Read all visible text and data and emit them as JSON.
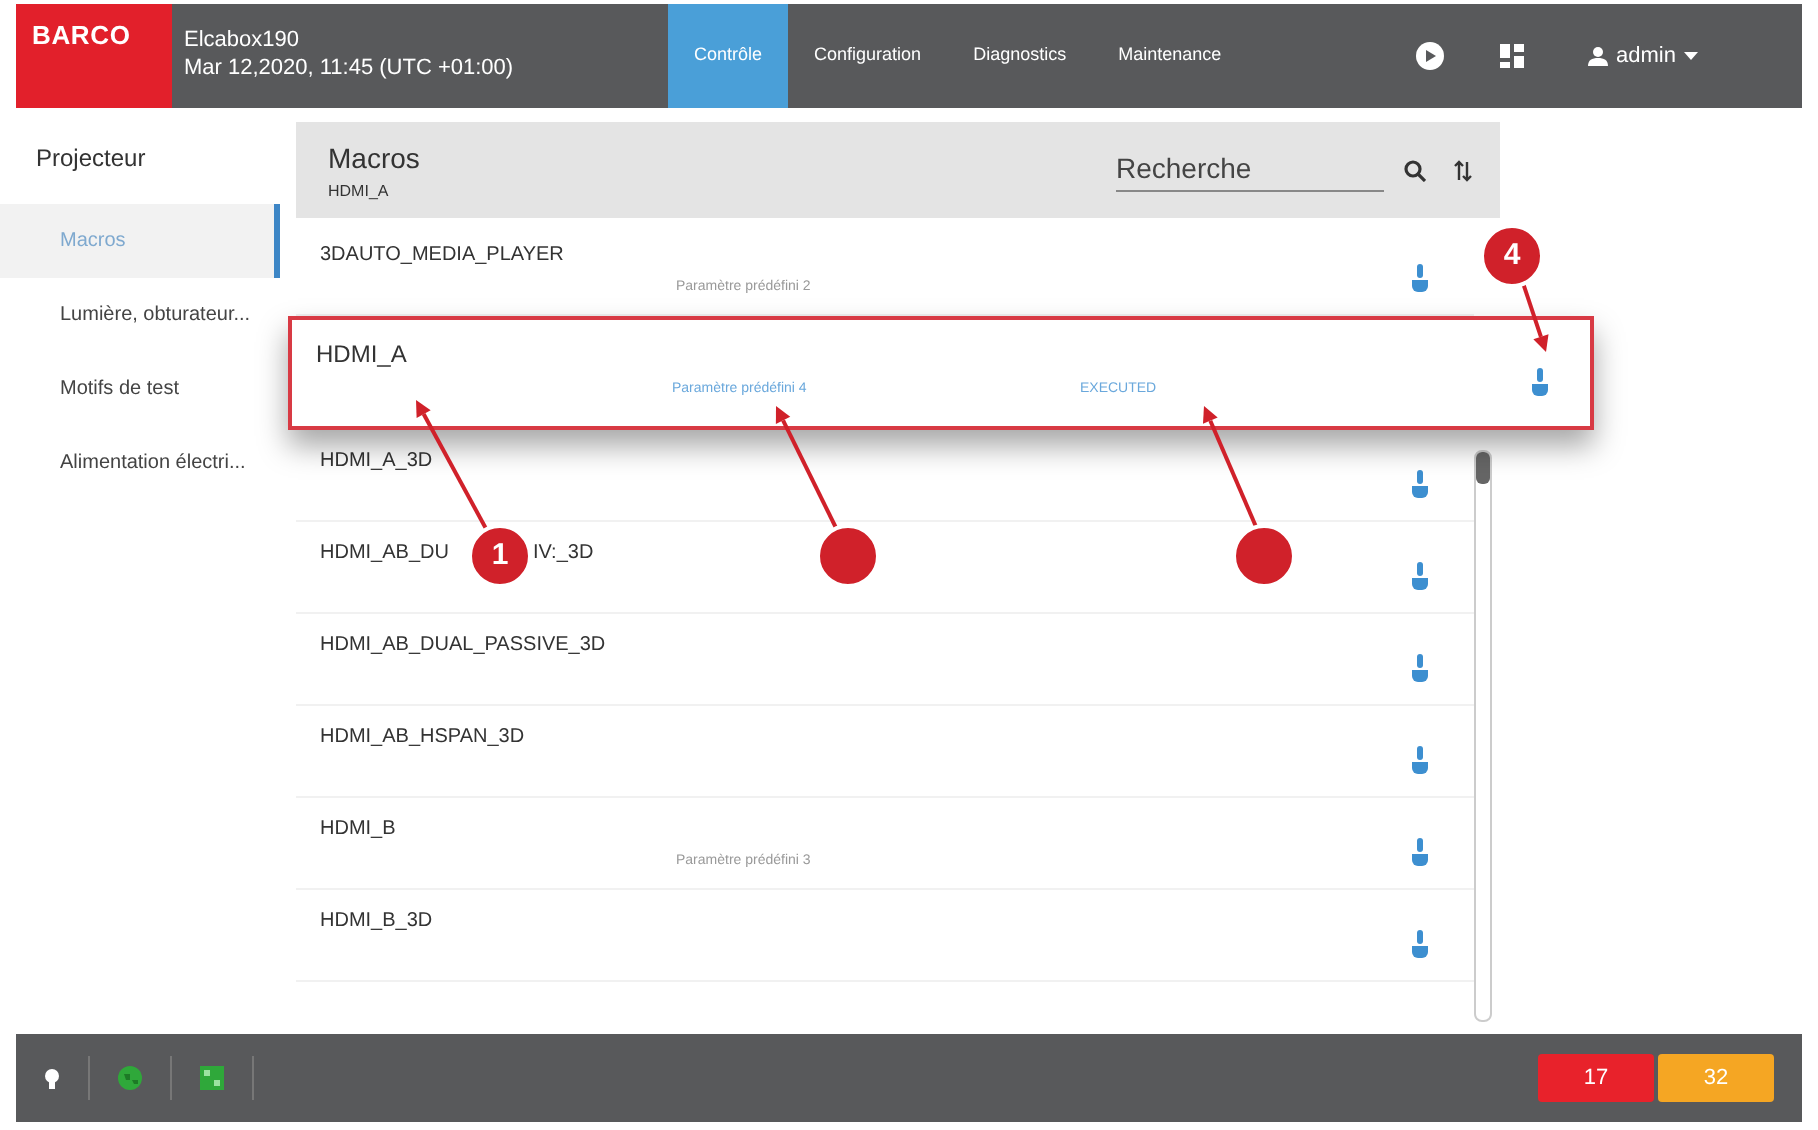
{
  "header": {
    "logo": "BARCO",
    "device": "Elcabox190",
    "datetime": "Mar 12,2020, 11:45 (UTC +01:00)",
    "tabs": [
      {
        "label": "Contrôle",
        "selected": true
      },
      {
        "label": "Configuration",
        "selected": false
      },
      {
        "label": "Diagnostics",
        "selected": false
      },
      {
        "label": "Maintenance",
        "selected": false
      }
    ],
    "user": "admin"
  },
  "sidebar": {
    "title": "Projecteur",
    "items": [
      {
        "label": "Macros",
        "selected": true
      },
      {
        "label": "Lumière, obturateur...",
        "selected": false
      },
      {
        "label": "Motifs de test",
        "selected": false
      },
      {
        "label": "Alimentation électri...",
        "selected": false
      }
    ]
  },
  "panel": {
    "title": "Macros",
    "subtitle": "HDMI_A",
    "search": {
      "placeholder": "Recherche"
    }
  },
  "rows": [
    {
      "name": "3DAUTO_MEDIA_PLAYER",
      "preset": "Paramètre prédéfini 2",
      "selected": false
    },
    {
      "name": "HDMI_A",
      "preset": "Paramètre prédéfini 4",
      "status": "EXECUTED",
      "selected": true
    },
    {
      "name": "HDMI_A_3D",
      "selected": false
    },
    {
      "name": "HDMI_AB_DU",
      "name_tail": "IV:_3D",
      "selected": false
    },
    {
      "name": "HDMI_AB_DUAL_PASSIVE_3D",
      "selected": false
    },
    {
      "name": "HDMI_AB_HSPAN_3D",
      "selected": false
    },
    {
      "name": "HDMI_B",
      "preset": "Paramètre prédéfini 3",
      "selected": false
    },
    {
      "name": "HDMI_B_3D",
      "selected": false
    }
  ],
  "footer": {
    "badges": [
      {
        "label": "17",
        "color": "#e8222b"
      },
      {
        "label": "32",
        "color": "#f5a623"
      }
    ]
  },
  "callouts": [
    {
      "kind": "numbered",
      "label": "1"
    },
    {
      "kind": "blank"
    },
    {
      "kind": "blank"
    },
    {
      "kind": "numbered",
      "label": "4"
    }
  ]
}
